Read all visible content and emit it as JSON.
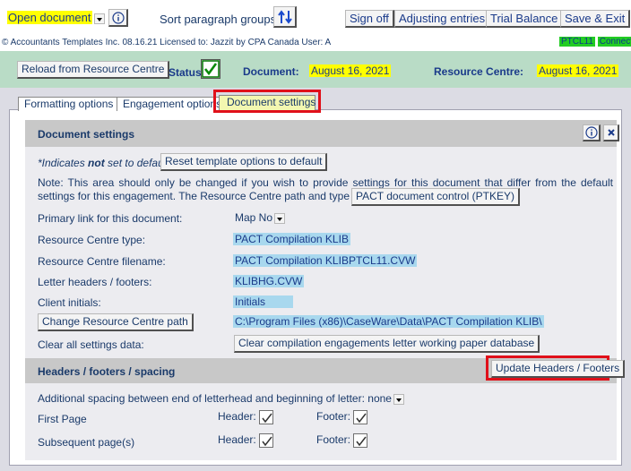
{
  "toolbar": {
    "open_document": "Open document",
    "sort_label": "Sort paragraph groups:",
    "sign_off": "Sign off",
    "adjusting_entries": "Adjusting entries",
    "trial_balance": "Trial Balance",
    "save_exit": "Save & Exit"
  },
  "infobar": {
    "copyright": "© Accountants Templates Inc. 08.16.21  Licensed to: Jazzit by CPA Canada   User: A",
    "ptcl": "PTCL11",
    "connected": "Connected"
  },
  "statusbar": {
    "reload": "Reload from Resource Centre",
    "status_label": "Status:",
    "document_label": "Document:",
    "document_date": "August 16, 2021",
    "rc_label": "Resource Centre:",
    "rc_date": "August 16, 2021"
  },
  "tabs": [
    {
      "label": "Formatting options"
    },
    {
      "label": "Engagement options"
    },
    {
      "label": "Document settings"
    }
  ],
  "doc_settings": {
    "title": "Document settings",
    "default_note_prefix": "*Indicates ",
    "default_note_bold": "not",
    "default_note_suffix": " set to default",
    "reset_button": "Reset template options to default",
    "note_text": "Note: This area should only be changed if you wish to provide settings for this document that differ from the default settings for this engagement.  The Resource Centre path and type is automatically set from",
    "pact_button": "PACT document control (PTKEY)",
    "rows": {
      "primary_link_label": "Primary link for this document:",
      "primary_link_value": "Map No",
      "rc_type_label": "Resource Centre type:",
      "rc_type_value": "PACT Compilation KLIB",
      "rc_filename_label": "Resource Centre filename:",
      "rc_filename_value": "PACT Compilation KLIBPTCL11.CVW",
      "letter_headers_label": "Letter headers / footers:",
      "letter_headers_value": "KLIBHG.CVW",
      "client_initials_label": "Client initials:",
      "client_initials_value": "Initials",
      "change_path_button": "Change Resource Centre path",
      "path_value": "C:\\Program Files (x86)\\CaseWare\\Data\\PACT Compilation KLIB\\",
      "clear_label": "Clear all settings data:",
      "clear_button": "Clear compilation engagements letter working paper database"
    }
  },
  "headers_section": {
    "title": "Headers / footers / spacing",
    "update_button": "Update Headers / Footers",
    "spacing_label": "Additional spacing between end of letterhead and beginning of letter:",
    "spacing_value": "none",
    "first_page_label": "First Page",
    "subsequent_label": "Subsequent page(s)",
    "header_label": "Header:",
    "footer_label": "Footer:"
  },
  "colors": {
    "accent_red": "#e0101a",
    "green_band": "#b9dcc6",
    "panel_grey": "#c8c8c8",
    "panel_body": "#ececf0",
    "highlight_blue": "#a8d8ee",
    "yellow": "#ffff00"
  }
}
